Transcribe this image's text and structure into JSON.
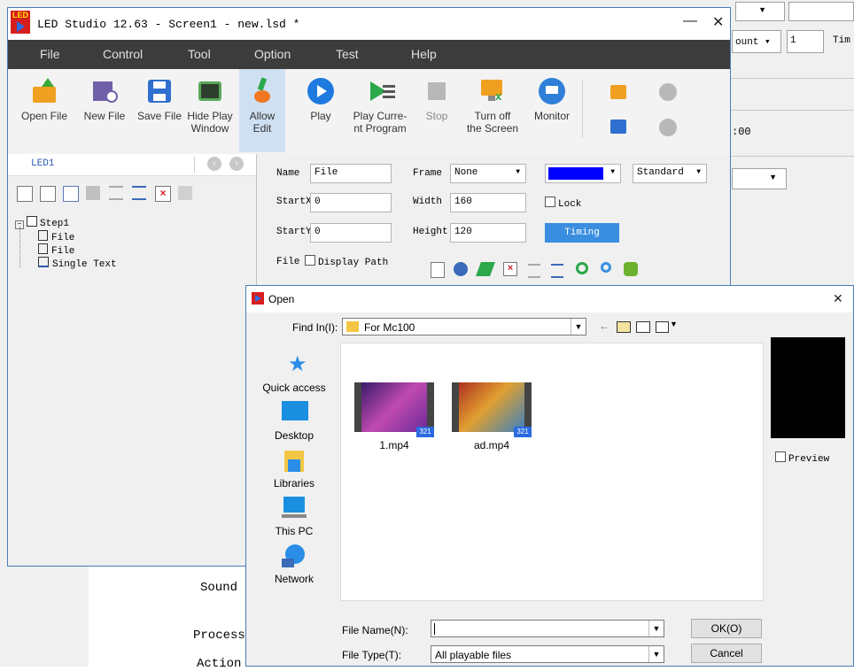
{
  "background": {
    "right_fields": {
      "count_label": "ount",
      "count_value": "1",
      "tim_label": "Tim",
      "value_00": ":00"
    },
    "bottom_labels": {
      "sound": "Sound",
      "process": "Process",
      "action": "Action"
    }
  },
  "app": {
    "title": "LED Studio 12.63 - Screen1 - new.lsd *",
    "logo_text": "LED",
    "minimize": "—",
    "close": "✕",
    "menu": [
      "File",
      "Control",
      "Tool",
      "Option",
      "Test",
      "Help"
    ],
    "toolbar": {
      "open_file": "Open File",
      "new_file": "New File",
      "save_file": "Save File",
      "hide_play_window_1": "Hide Play",
      "hide_play_window_2": "Window",
      "allow_edit_1": "Allow",
      "allow_edit_2": "Edit",
      "play": "Play",
      "play_current_1": "Play Curre-",
      "play_current_2": "nt Program",
      "stop": "Stop",
      "turn_off_1": "Turn off",
      "turn_off_2": "the Screen",
      "monitor": "Monitor"
    },
    "left_panel": {
      "tab": "LED1",
      "tree": {
        "root": "Step1",
        "children": [
          "File",
          "File",
          "Single Text"
        ]
      }
    },
    "properties": {
      "name_label": "Name",
      "name_value": "File",
      "frame_label": "Frame",
      "frame_value": "None",
      "style_value": "Standard",
      "startx_label": "StartX",
      "startx_value": "0",
      "width_label": "Width",
      "width_value": "160",
      "lock_label": "Lock",
      "starty_label": "StartY",
      "starty_value": "0",
      "height_label": "Height",
      "height_value": "120",
      "timing_button": "Timing",
      "file_label": "File",
      "display_path_label": "Display Path",
      "color_value": "#0000ff"
    }
  },
  "dialog": {
    "title": "Open",
    "close": "✕",
    "find_in_label": "Find In(I):",
    "find_in_value": "For Mc100",
    "places": [
      "Quick access",
      "Desktop",
      "Libraries",
      "This PC",
      "Network"
    ],
    "files": [
      {
        "name": "1.mp4",
        "badge": "321"
      },
      {
        "name": "ad.mp4",
        "badge": "321"
      }
    ],
    "preview_label": "Preview",
    "file_name_label": "File Name(N):",
    "file_name_value": "",
    "file_type_label": "File Type(T):",
    "file_type_value": "All playable files",
    "ok_button": "OK(O)",
    "cancel_button": "Cancel"
  }
}
